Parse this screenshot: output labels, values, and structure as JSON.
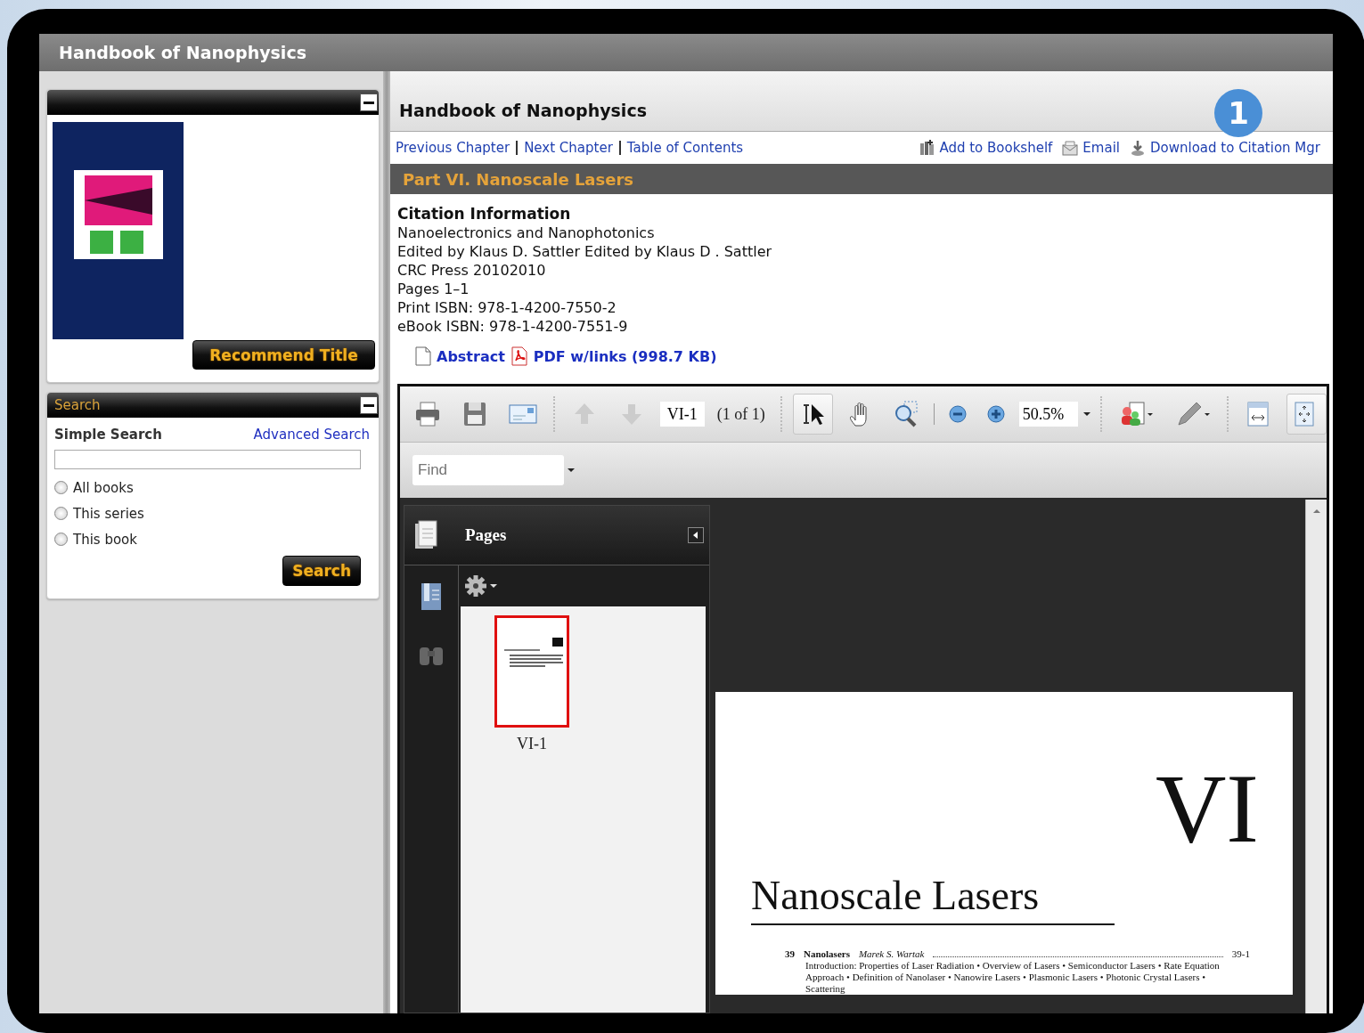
{
  "app_title": "Handbook of Nanophysics",
  "callout": {
    "label": "1"
  },
  "book_panel": {
    "recommend_button": "Recommend Title"
  },
  "search_panel": {
    "title": "Search",
    "simple_label": "Simple Search",
    "advanced_link": "Advanced Search",
    "scopes": [
      {
        "label": "All books",
        "selected": false
      },
      {
        "label": "This series",
        "selected": false
      },
      {
        "label": "This book",
        "selected": false
      }
    ],
    "button": "Search"
  },
  "main": {
    "title": "Handbook of Nanophysics",
    "nav_links": [
      "Previous Chapter",
      "Next Chapter",
      "Table of Contents"
    ],
    "actions": [
      {
        "kind": "bookshelf",
        "label": "Add to Bookshelf"
      },
      {
        "kind": "email",
        "label": "Email"
      },
      {
        "kind": "download",
        "label": "Download to Citation Mgr"
      }
    ],
    "part_title": "Part VI. Nanoscale Lasers",
    "citation": {
      "heading": "Citation Information",
      "lines": [
        "Nanoelectronics and Nanophotonics",
        "Edited by Klaus D. Sattler Edited by Klaus D . Sattler",
        "CRC Press 20102010",
        "Pages 1–1",
        "Print ISBN: 978-1-4200-7550-2",
        "eBook ISBN: 978-1-4200-7551-9"
      ]
    },
    "files": [
      {
        "kind": "document",
        "label": "Abstract"
      },
      {
        "kind": "pdf",
        "label": "PDF w/links (998.7 KB)"
      }
    ]
  },
  "viewer": {
    "tools": [
      {
        "kind": "print",
        "on": false
      },
      {
        "kind": "save",
        "on": false
      },
      {
        "kind": "email",
        "on": false
      },
      {
        "kind": "sep"
      },
      {
        "kind": "up",
        "on": false
      },
      {
        "kind": "down",
        "on": false
      },
      {
        "kind": "page"
      },
      {
        "kind": "sep"
      },
      {
        "kind": "select",
        "on": true
      },
      {
        "kind": "hand",
        "on": false
      },
      {
        "kind": "marquee",
        "on": false
      },
      {
        "kind": "thin"
      },
      {
        "kind": "zoomout",
        "on": false
      },
      {
        "kind": "zoomin",
        "on": false
      },
      {
        "kind": "zoom"
      },
      {
        "kind": "sep"
      },
      {
        "kind": "share",
        "on": false
      },
      {
        "kind": "pen",
        "on": false
      },
      {
        "kind": "sep"
      },
      {
        "kind": "fitwidth",
        "on": false
      },
      {
        "kind": "fitpage",
        "on": true
      }
    ],
    "page_field": "VI-1",
    "page_count": "(1 of 1)",
    "zoom_value": "50.5%",
    "find": {
      "placeholder": "Find"
    },
    "pages_panel": {
      "title": "Pages",
      "thumbnails": [
        {
          "label": "VI-1",
          "selected": true
        }
      ]
    },
    "page": {
      "part_number": "VI",
      "title": "Nanoscale Lasers",
      "toc": [
        {
          "number": "39",
          "title": "Nanolasers",
          "author": "Marek S. Wartak",
          "page": "39-1",
          "sections": "Introduction: Properties of Laser Radiation • Overview of Lasers • Semiconductor Lasers • Rate Equation Approach • Definition of Nanolaser • Nanowire Lasers • Plasmonic Lasers • Photonic Crystal Lasers • Scattering"
        }
      ]
    }
  }
}
